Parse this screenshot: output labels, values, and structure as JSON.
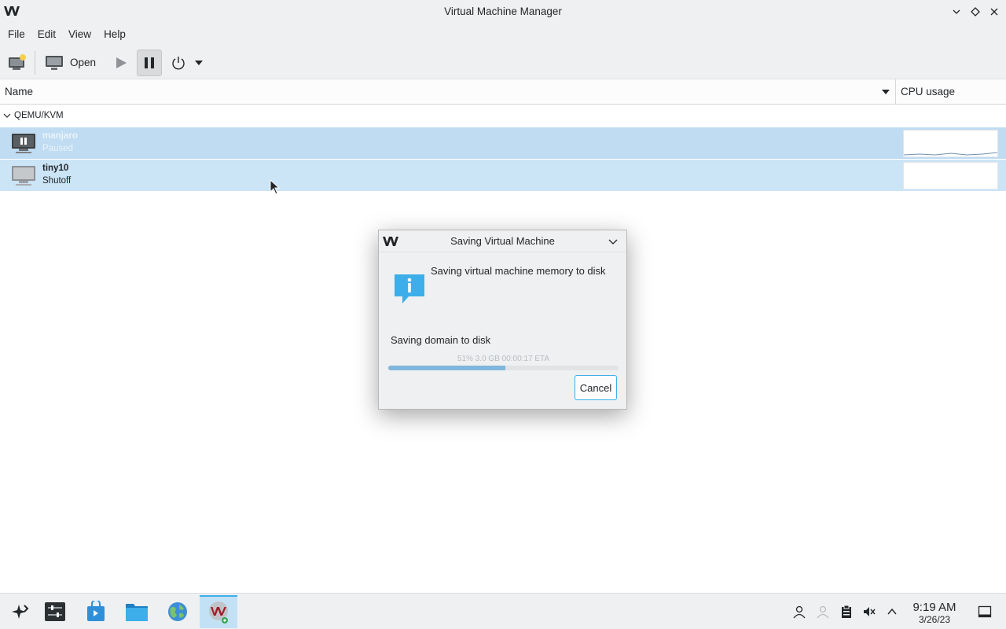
{
  "window": {
    "title": "Virtual Machine Manager",
    "controls": [
      "minimize-icon",
      "maximize-icon",
      "close-icon"
    ]
  },
  "menubar": {
    "items": [
      "File",
      "Edit",
      "View",
      "Help"
    ]
  },
  "toolbar": {
    "new_vm_icon": "new-vm-icon",
    "open_label": "Open",
    "run_icon": "play-icon",
    "pause_icon": "pause-icon",
    "shutdown_icon": "power-icon",
    "shutdown_menu_icon": "chevron-down-icon"
  },
  "columns": {
    "name": "Name",
    "cpu": "CPU usage"
  },
  "group": {
    "label": "QEMU/KVM"
  },
  "vms": [
    {
      "name": "manjaro",
      "state": "Paused",
      "icon": "vm-paused-icon"
    },
    {
      "name": "tiny10",
      "state": "Shutoff",
      "icon": "vm-shutoff-icon"
    }
  ],
  "dialog": {
    "title": "Saving Virtual Machine",
    "heading": "Saving virtual machine memory to disk",
    "status": "Saving domain to disk",
    "progress_text": "51% 3.0 GB 00:00:17 ETA",
    "progress": 0.51,
    "cancel_label": "Cancel",
    "info_icon": "info-icon"
  },
  "taskbar": {
    "items": [
      "launcher-icon",
      "system-settings-icon",
      "discover-icon",
      "file-manager-icon",
      "browser-icon",
      "virt-manager-icon"
    ],
    "tray": [
      "user-icon",
      "network-icon",
      "clipboard-icon",
      "volume-muted-icon",
      "chevron-up-icon"
    ],
    "time": "9:19 AM",
    "date": "3/26/23",
    "show_desktop_icon": "show-desktop-icon"
  },
  "colors": {
    "selection": "#c2dff4",
    "accent": "#3daee9",
    "chrome": "#eff0f1"
  }
}
